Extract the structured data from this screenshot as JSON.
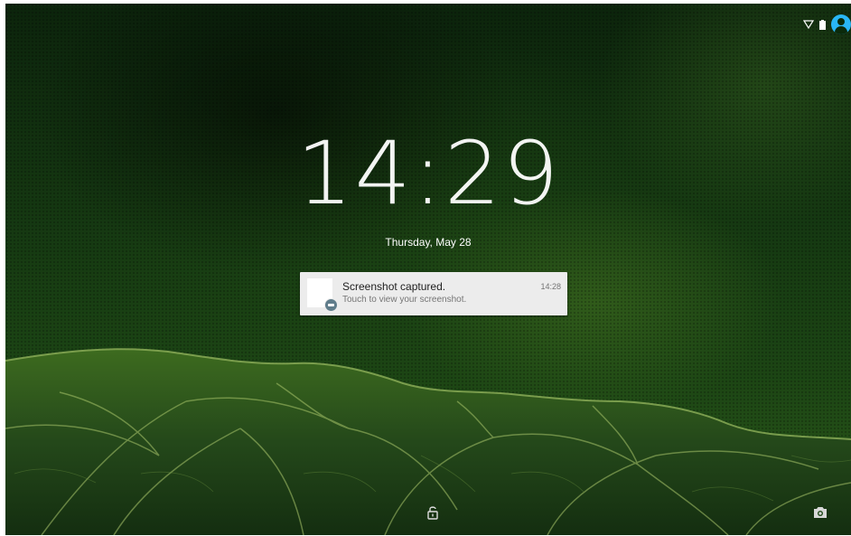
{
  "status_bar": {
    "icons": [
      "wifi-icon",
      "battery-icon",
      "user-avatar-icon"
    ],
    "accent_color": "#29b6f6"
  },
  "lockscreen": {
    "time": "14:29",
    "date": "Thursday, May 28"
  },
  "notification": {
    "title": "Screenshot captured.",
    "text": "Touch to view your screenshot.",
    "time": "14:28",
    "badge_icon": "screenshot-app-icon",
    "badge_color": "#607d8b"
  },
  "bottom_bar": {
    "left_icon": "lock-icon",
    "right_icon": "camera-icon"
  }
}
